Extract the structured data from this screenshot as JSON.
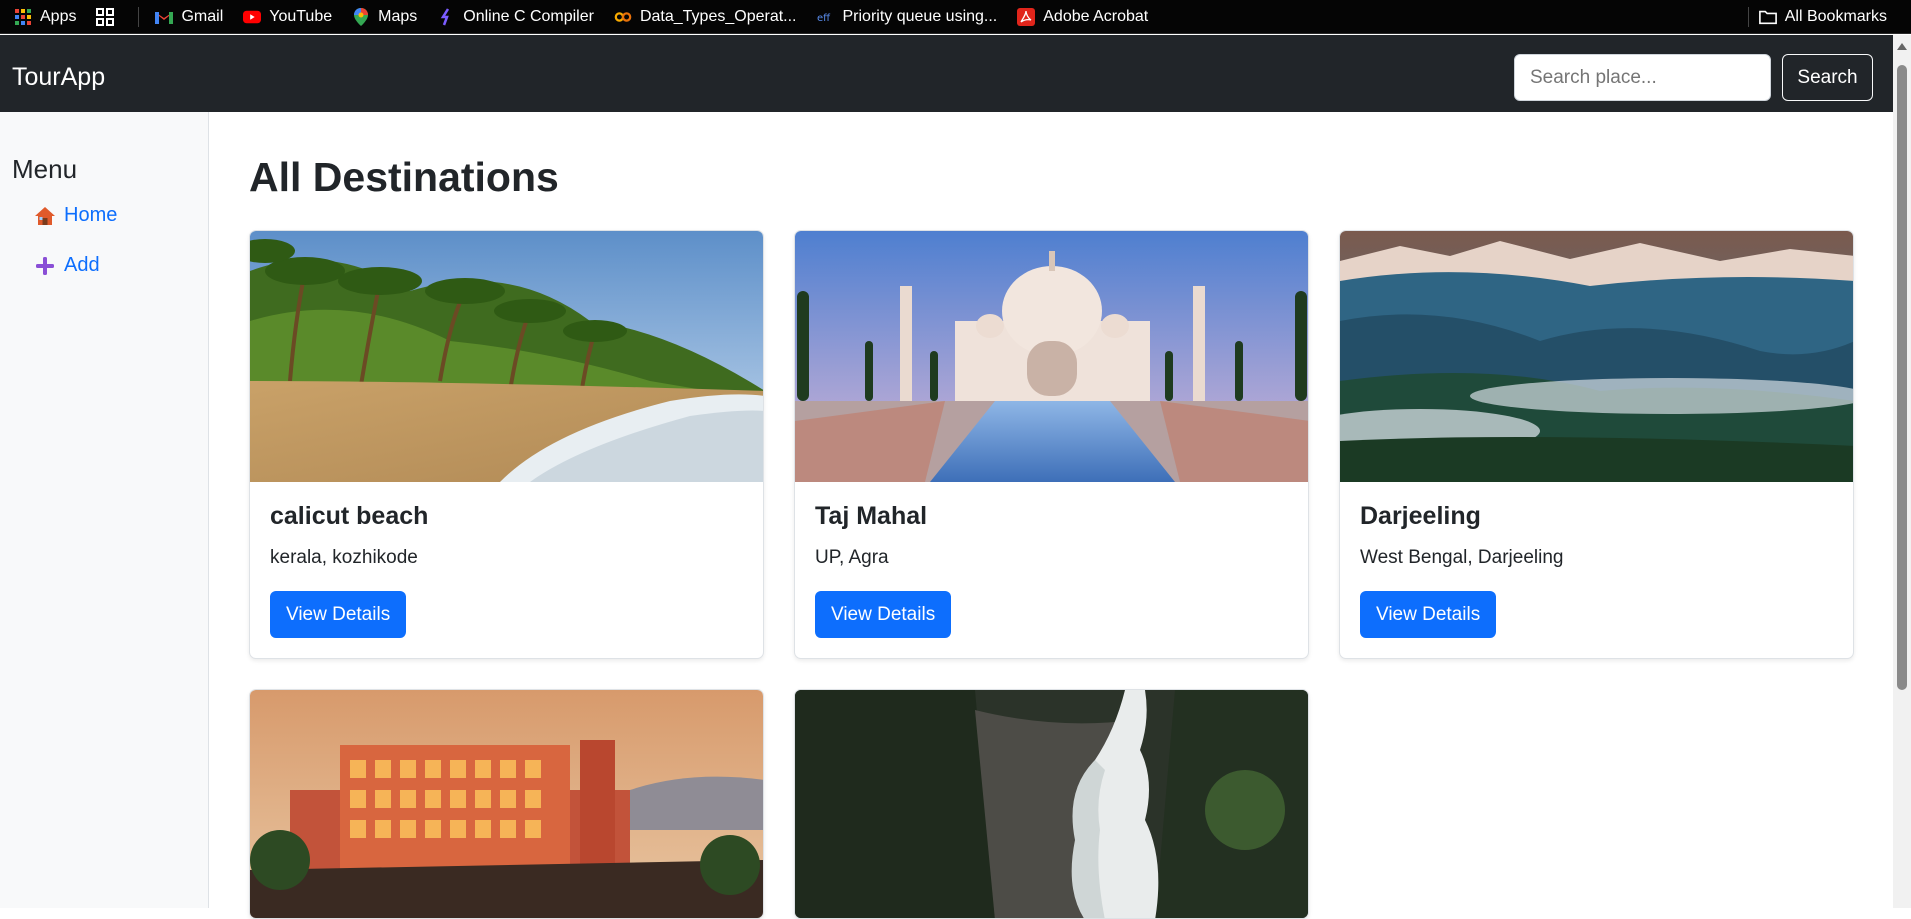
{
  "bookmarks": {
    "items": [
      {
        "label": "Apps",
        "icon": "apps-grid-icon"
      },
      {
        "label": "",
        "icon": "tab-groups-icon"
      },
      {
        "label": "Gmail",
        "icon": "gmail-icon"
      },
      {
        "label": "YouTube",
        "icon": "youtube-icon"
      },
      {
        "label": "Maps",
        "icon": "maps-pin-icon"
      },
      {
        "label": "Online C Compiler",
        "icon": "compiler-icon"
      },
      {
        "label": "Data_Types_Operat...",
        "icon": "colab-icon"
      },
      {
        "label": "Priority queue using...",
        "icon": "gfg-icon"
      },
      {
        "label": "Adobe Acrobat",
        "icon": "acrobat-icon"
      }
    ],
    "all_bookmarks": "All Bookmarks"
  },
  "navbar": {
    "brand": "TourApp",
    "search_placeholder": "Search place...",
    "search_label": "Search"
  },
  "sidebar": {
    "title": "Menu",
    "items": [
      {
        "label": "Home",
        "icon": "house-icon"
      },
      {
        "label": "Add",
        "icon": "plus-icon"
      }
    ]
  },
  "main": {
    "title": "All Destinations",
    "cards": [
      {
        "title": "calicut beach",
        "location": "kerala, kozhikode",
        "button": "View Details",
        "image": "beach-photo"
      },
      {
        "title": "Taj Mahal",
        "location": "UP, Agra",
        "button": "View Details",
        "image": "taj-mahal-photo"
      },
      {
        "title": "Darjeeling",
        "location": "West Bengal, Darjeeling",
        "button": "View Details",
        "image": "mountains-photo"
      },
      {
        "title": "",
        "location": "",
        "button": "",
        "image": "hawa-mahal-photo"
      },
      {
        "title": "",
        "location": "",
        "button": "",
        "image": "waterfall-photo"
      }
    ]
  },
  "colors": {
    "navbar_bg": "#212529",
    "primary": "#0d6efd",
    "sidebar_bg": "#f8f9fa"
  }
}
